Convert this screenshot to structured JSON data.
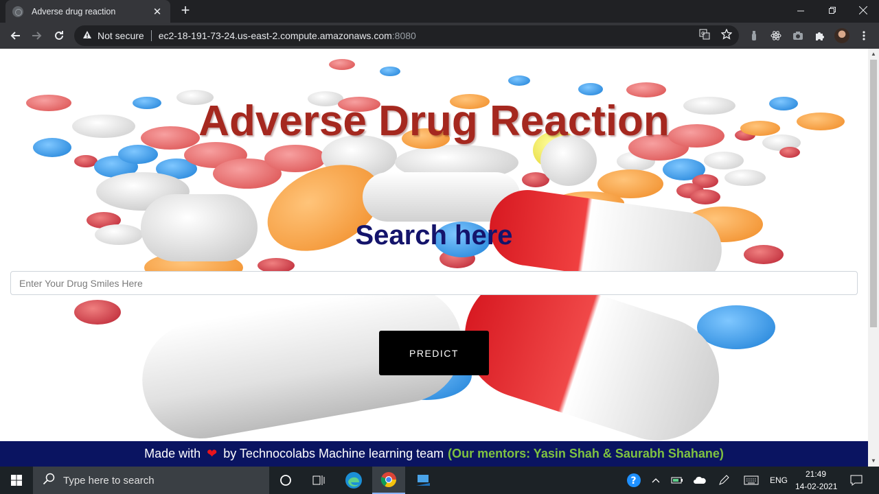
{
  "browser": {
    "tab_title": "Adverse drug reaction",
    "tab_close": "✕",
    "new_tab": "+",
    "security_label": "Not secure",
    "url_host": "ec2-18-191-73-24.us-east-2.compute.amazonaws.com",
    "url_port": ":8080"
  },
  "page": {
    "title": "Adverse Drug Reaction",
    "search_heading": "Search here",
    "search_placeholder": "Enter Your Drug Smiles Here",
    "search_value": "",
    "predict_label": "PREDICT",
    "footer": {
      "made_with": "Made with",
      "heart": "❤",
      "team": "by Technocolabs Machine learning team",
      "mentors": "(Our mentors: Yasin Shah & Saurabh Shahane)"
    }
  },
  "taskbar": {
    "search_placeholder": "Type here to search",
    "language": "ENG",
    "time": "21:49",
    "date": "14-02-2021"
  },
  "colors": {
    "title": "#a5281f",
    "search_heading": "#14146b",
    "footer_bg": "#0a1461",
    "mentors": "#7fc241"
  }
}
